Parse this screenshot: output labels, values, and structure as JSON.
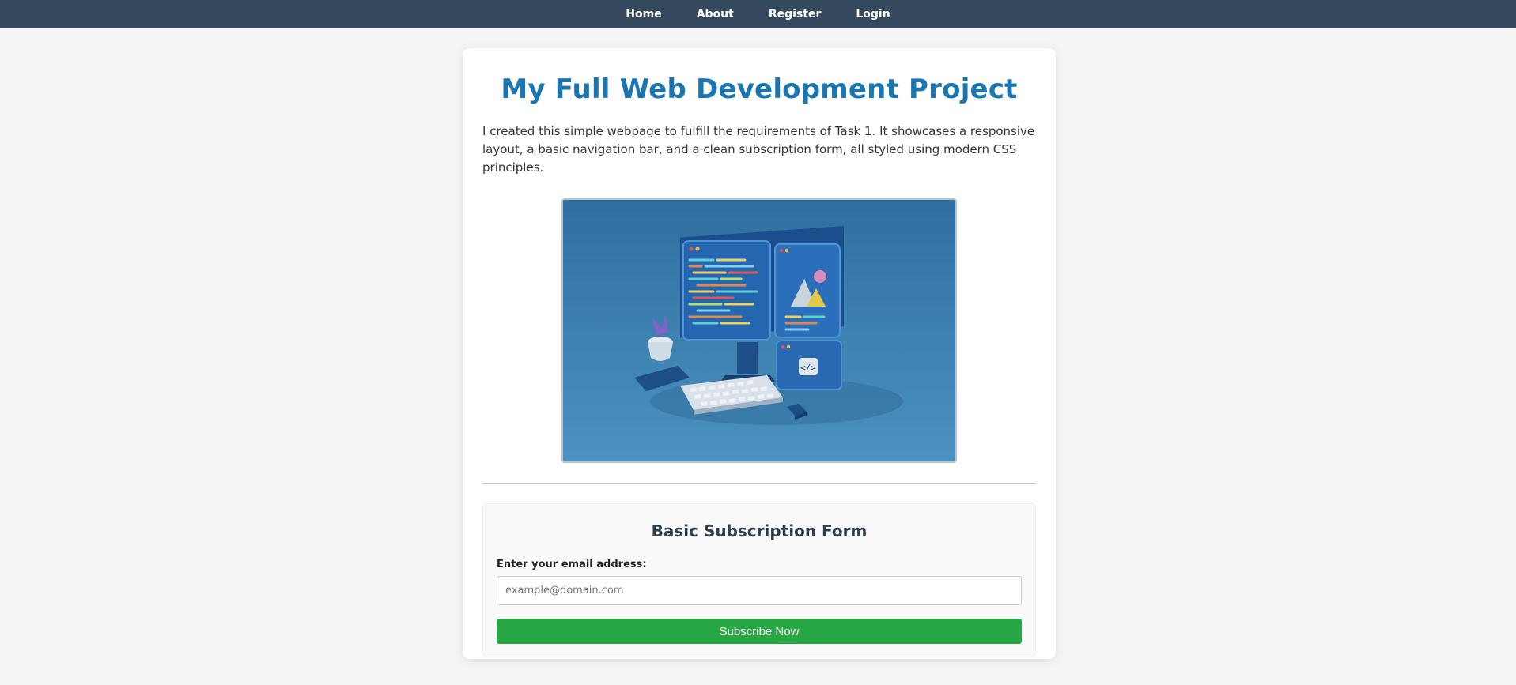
{
  "nav": {
    "items": [
      {
        "label": "Home"
      },
      {
        "label": "About"
      },
      {
        "label": "Register"
      },
      {
        "label": "Login"
      }
    ]
  },
  "main": {
    "title": "My Full Web Development Project",
    "intro": "I created this simple webpage to fulfill the requirements of Task 1. It showcases a responsive layout, a basic navigation bar, and a clean subscription form, all styled using modern CSS principles.",
    "hero_image_icon": "code-snippet-icon"
  },
  "form": {
    "title": "Basic Subscription Form",
    "email_label": "Enter your email address:",
    "email_placeholder": "example@domain.com",
    "email_value": "",
    "button_label": "Subscribe Now"
  },
  "colors": {
    "nav_bg": "#34495e",
    "title": "#1a76b3",
    "form_title": "#2c3e50",
    "button": "#28a745"
  }
}
